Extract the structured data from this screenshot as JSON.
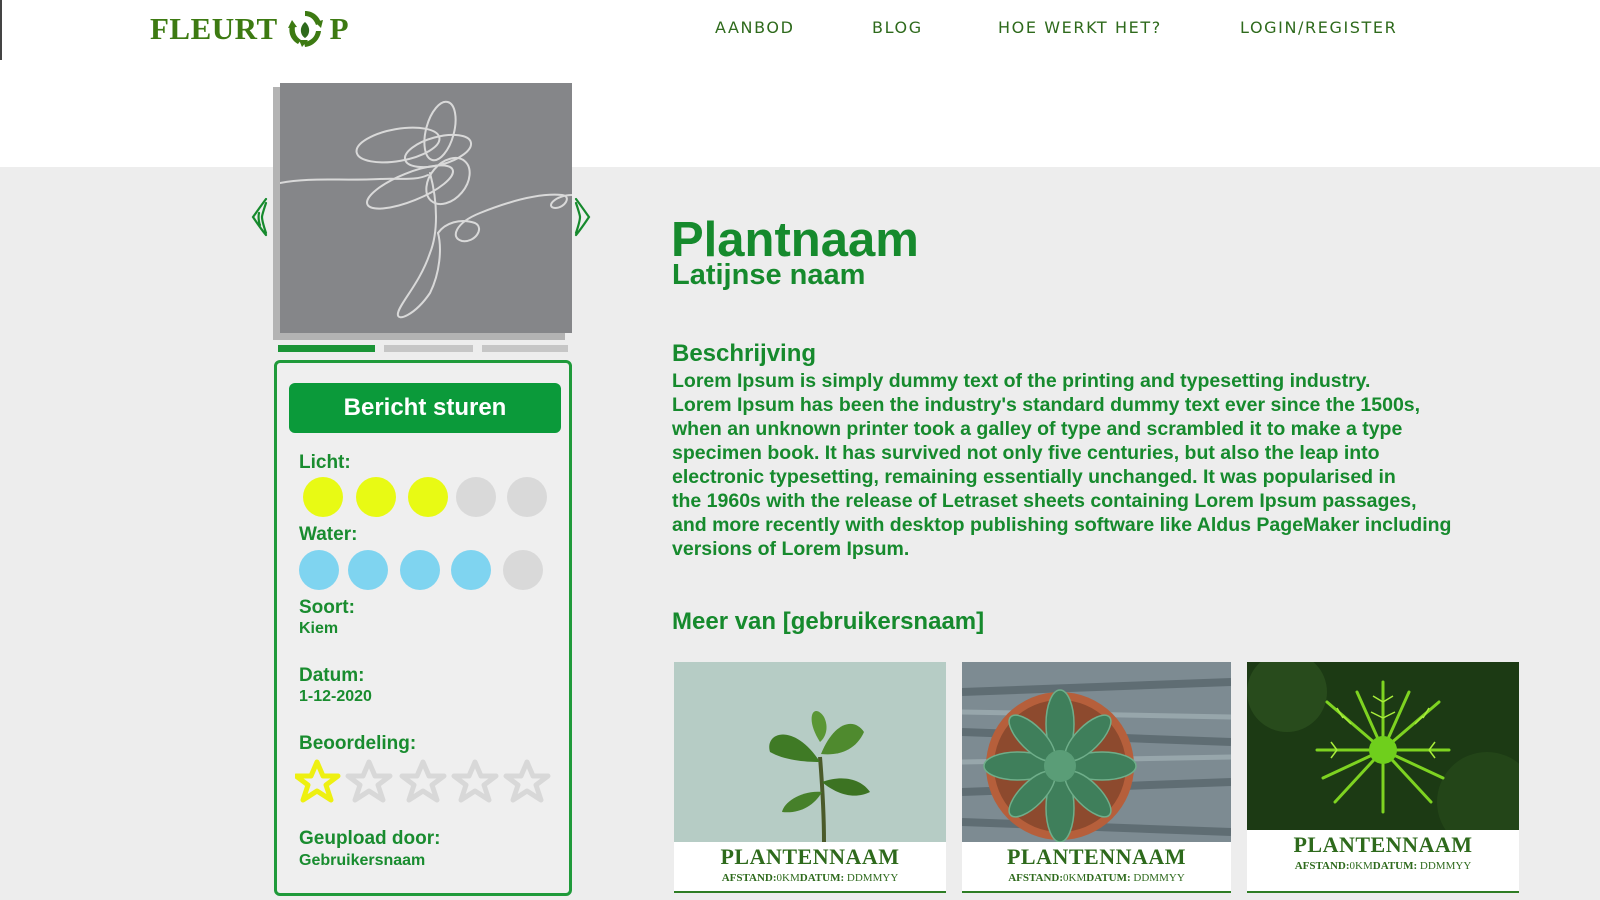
{
  "header": {
    "logo_left": "FLEURT",
    "logo_right": "P",
    "logo_icon": "recycle-leaf-icon",
    "nav": [
      "AANBOD",
      "BLOG",
      "HOE WERKT HET?",
      "LOGIN/REGISTER"
    ]
  },
  "gallery": {
    "image_icon": "flower-sketch-icon",
    "prev_icon": "arrow-left-icon",
    "next_icon": "arrow-right-icon",
    "slide_count": 3,
    "active_slide": 1
  },
  "info": {
    "send_button": "Bericht sturen",
    "light_label": "Licht:",
    "light_level": 3,
    "light_max": 5,
    "water_label": "Water:",
    "water_level": 4,
    "water_max": 5,
    "type_label": "Soort:",
    "type_value": "Kiem",
    "date_label": "Datum:",
    "date_value": "1-12-2020",
    "rating_label": "Beoordeling:",
    "rating": 1,
    "rating_max": 5,
    "uploader_label": "Geupload door:",
    "uploader_value": "Gebruikersnaam"
  },
  "plant": {
    "name": "Plantnaam",
    "latin": "Latijnse naam",
    "desc_heading": "Beschrijving",
    "desc_lines": [
      "Lorem Ipsum is simply dummy text of the printing and typesetting industry.",
      "Lorem Ipsum has been the industry's standard dummy text ever since the 1500s,",
      "when an unknown printer took a galley of type and scrambled it to make a type",
      "specimen book. It has survived not only five centuries, but also the leap into",
      "electronic typesetting, remaining essentially unchanged. It was popularised in",
      "the 1960s with the release of Letraset sheets containing Lorem Ipsum passages,",
      "and more recently with desktop publishing software like Aldus PageMaker including",
      "versions of Lorem Ipsum."
    ]
  },
  "more": {
    "heading": "Meer van [gebruikersnaam]",
    "cards": [
      {
        "name": "PLANTENNAAM",
        "dist_label": "AFSTAND:",
        "dist_value": "0KM",
        "date_label": "DATUM:",
        "date_value": "DDMMYY",
        "photo": "sprout-photo"
      },
      {
        "name": "PLANTENNAAM",
        "dist_label": "AFSTAND:",
        "dist_value": "0KM",
        "date_label": "DATUM:",
        "date_value": "DDMMYY",
        "photo": "succulent-photo"
      },
      {
        "name": "PLANTENNAAM",
        "dist_label": "AFSTAND:",
        "dist_value": "0KM",
        "date_label": "DATUM:",
        "date_value": "DDMMYY",
        "photo": "fern-photo"
      }
    ]
  },
  "colors": {
    "brand_green": "#168a2d",
    "button_green": "#0b9a3a",
    "light_on": "#e8fa14",
    "water_on": "#7fd4f0",
    "dot_off": "#d9d9d9",
    "star_on": "#eef010",
    "star_off": "#d8d8d8"
  }
}
